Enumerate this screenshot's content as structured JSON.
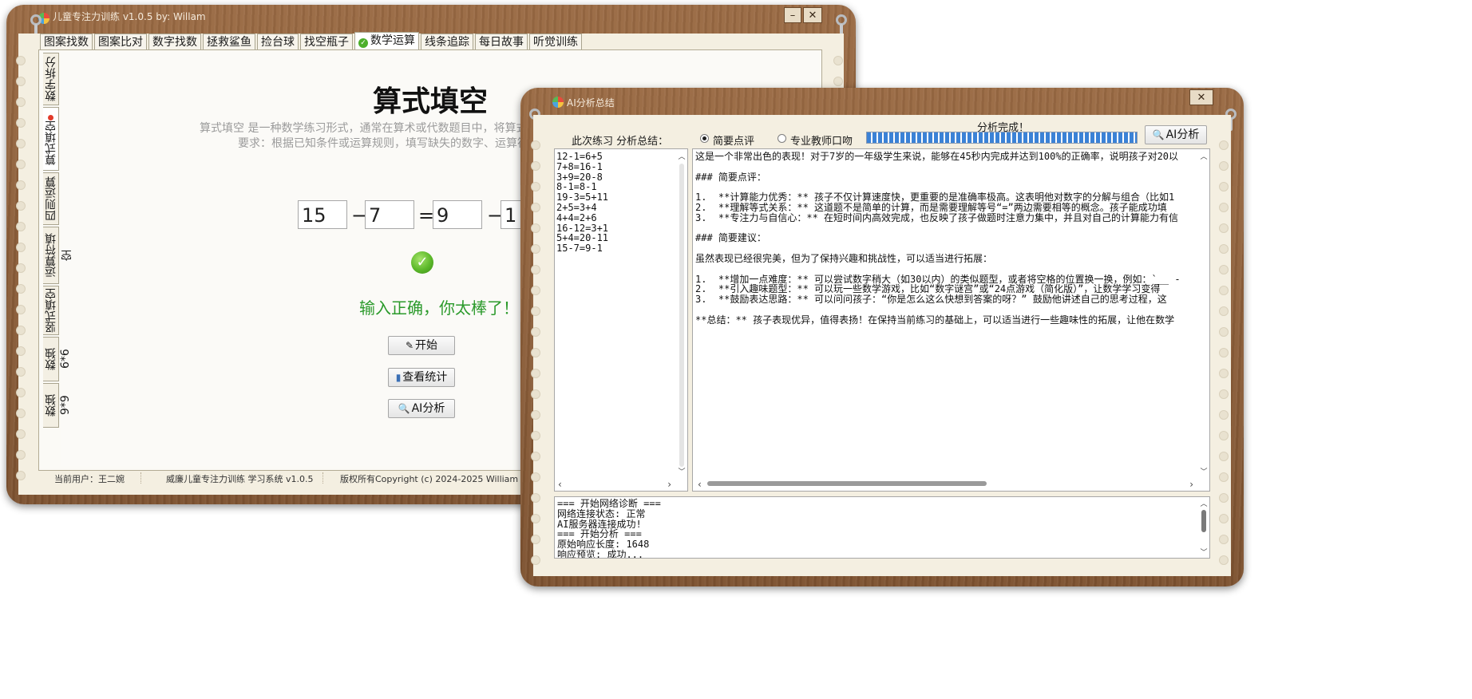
{
  "main_window": {
    "title": "儿童专注力训练 v1.0.5 by: Willam",
    "min_label": "–",
    "close_label": "✕",
    "tabs": [
      "图案找数",
      "图案比对",
      "数字找数",
      "拯救鲨鱼",
      "捡台球",
      "找空瓶子",
      "数学运算",
      "线条追踪",
      "每日故事",
      "听觉训练"
    ],
    "active_tab_index": 6,
    "side_tabs": [
      "数字拆分",
      "算式填空",
      "四则运算",
      "运算符填空",
      "竖式填空",
      "数独6*6",
      "数独9*9"
    ],
    "active_side_tab_index": 1,
    "heading": "算式填空",
    "desc_line1": "算式填空 是一种数学练习形式，通常在算术或代数题目中，将算式",
    "desc_line2": "要求：根据已知条件或运算规则，填写缺失的数字、运算符",
    "equation": {
      "a": "15",
      "op1": "−",
      "b": "7",
      "eq": "=",
      "c": "9",
      "op2": "−",
      "d": "1"
    },
    "result_text": "输入正确，你太棒了！",
    "buttons": {
      "start": "开始",
      "stats": "查看统计",
      "ai": "AI分析"
    },
    "status": {
      "user": "当前用户：王二婉",
      "system": "威廉儿童专注力训练 学习系统 v1.0.5",
      "copyright": "版权所有Copyright (c) 2024-2025 William Lv. A"
    }
  },
  "ai_window": {
    "title": "AI分析总结",
    "close_label": "✕",
    "summary_label": "此次练习 分析总结：",
    "radio_brief": "简要点评",
    "radio_pro": "专业教师口吻",
    "selected_mode": "简要点评",
    "status_text": "分析完成！",
    "progress": 1.0,
    "analyze_button": "AI分析",
    "exercises": [
      "12-1=6+5",
      "7+8=16-1",
      "3+9=20-8",
      "8-1=8-1",
      "19-3=5+11",
      "2+5=3+4",
      "4+4=2+6",
      "16-12=3+1",
      "5+4=20-11",
      "15-7=9-1"
    ],
    "analysis_lines": [
      "这是一个非常出色的表现！对于7岁的一年级学生来说，能够在45秒内完成并达到100%的正确率，说明孩子对20以",
      "",
      "### 简要点评：",
      "",
      "1.  **计算能力优秀：** 孩子不仅计算速度快，更重要的是准确率极高。这表明他对数字的分解与组合（比如1",
      "2.  **理解等式关系：** 这道题不是简单的计算，而是需要理解等号“=”两边需要相等的概念。孩子能成功填",
      "3.  **专注力与自信心：** 在短时间内高效完成，也反映了孩子做题时注意力集中，并且对自己的计算能力有信",
      "",
      "### 简要建议：",
      "",
      "虽然表现已经很完美，但为了保持兴趣和挑战性，可以适当进行拓展：",
      "",
      "1.  **增加一点难度：** 可以尝试数字稍大（如30以内）的类似题型，或者将空格的位置换一换，例如：`__ -",
      "2.  **引入趣味题型：** 可以玩一些数学游戏，比如“数字谜宫”或“24点游戏（简化版）”，让数学学习变得",
      "3.  **鼓励表达思路：** 可以问问孩子：“你是怎么这么快想到答案的呀？” 鼓励他讲述自己的思考过程，这",
      "",
      "**总结：** 孩子表现优异，值得表扬！在保持当前练习的基础上，可以适当进行一些趣味性的拓展，让他在数学"
    ],
    "log_lines": [
      "=== 开始网络诊断 ===",
      "网络连接状态: 正常",
      "AI服务器连接成功!",
      "=== 开始分析 ===",
      "原始响应长度: 1648",
      "响应预览: 成功..."
    ]
  }
}
